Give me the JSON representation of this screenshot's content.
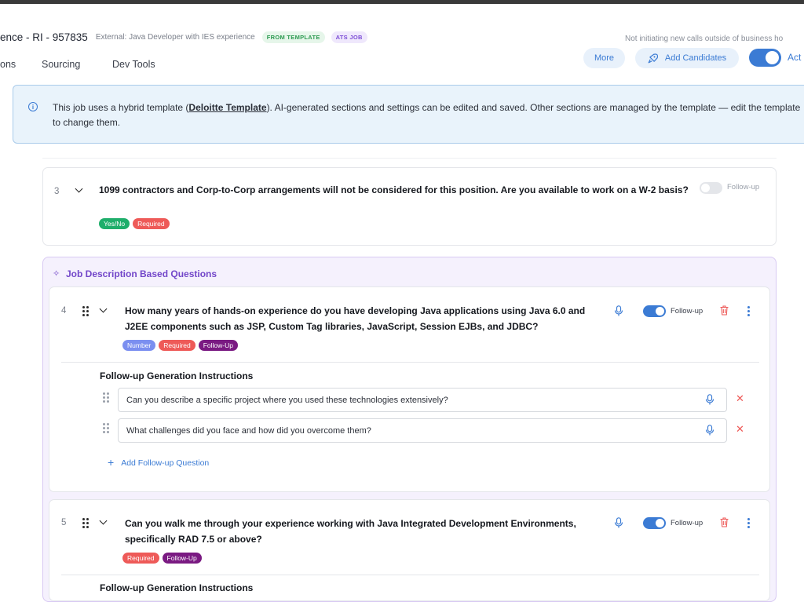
{
  "header": {
    "title": "ence - RI - 957835",
    "subtitle": "External: Java Developer with IES experience",
    "badge_template": "FROM TEMPLATE",
    "badge_ats": "ATS JOB",
    "notice": "Not initiating new calls outside of business ho",
    "tabs": [
      {
        "label": "ons"
      },
      {
        "label": "Sourcing"
      },
      {
        "label": "Dev Tools"
      }
    ],
    "more_label": "More",
    "add_candidates_label": "Add Candidates",
    "active_label": "Act"
  },
  "info_banner": {
    "text_before": "This job uses a hybrid template (",
    "link_text": "Deloitte Template",
    "text_after": "). AI-generated sections and settings can be edited and saved. Other sections are managed by the template — edit the template to change them."
  },
  "question3": {
    "number": "3",
    "text": "1099 contractors and Corp-to-Corp arrangements will not be considered for this position. Are you available to work on a W-2 basis?",
    "tags": [
      "Yes/No",
      "Required"
    ],
    "followup_label": "Follow-up",
    "followup_enabled": false
  },
  "jd_section": {
    "title": "Job Description Based Questions",
    "questions": [
      {
        "number": "4",
        "text": "How many years of hands-on experience do you have developing Java applications using Java 6.0 and J2EE components such as JSP, Custom Tag libraries, JavaScript, Session EJBs, and JDBC?",
        "tags": [
          "Number",
          "Required",
          "Follow-Up"
        ],
        "followup_label": "Follow-up",
        "followup_enabled": true,
        "followup_title": "Follow-up Generation Instructions",
        "followups": [
          "Can you describe a specific project where you used these technologies extensively?",
          "What challenges did you face and how did you overcome them?"
        ],
        "add_followup_label": "Add Follow-up Question"
      },
      {
        "number": "5",
        "text": "Can you walk me through your experience working with Java Integrated Development Environments, specifically RAD 7.5 or above?",
        "tags": [
          "Required",
          "Follow-Up"
        ],
        "followup_label": "Follow-up",
        "followup_enabled": true,
        "followup_title": "Follow-up Generation Instructions"
      }
    ]
  },
  "colors": {
    "accent": "#3b7bd4",
    "purple": "#7246c9",
    "required": "#ee5a58",
    "yesno": "#1fae6b",
    "number": "#7b8ff0",
    "followup_tag": "#7a1a82"
  }
}
